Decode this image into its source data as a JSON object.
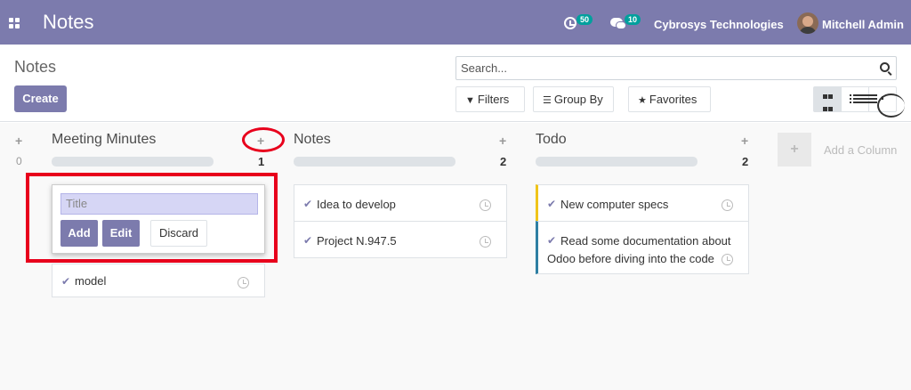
{
  "navbar": {
    "app_title": "Notes",
    "activity_count": "50",
    "message_count": "10",
    "company": "Cybrosys Technologies",
    "user": "Mitchell Admin"
  },
  "control_panel": {
    "breadcrumb": "Notes",
    "create_label": "Create",
    "search_placeholder": "Search...",
    "filters_label": "Filters",
    "groupby_label": "Group By",
    "favorites_label": "Favorites",
    "views": [
      "kanban",
      "list",
      "activity"
    ],
    "active_view": "kanban"
  },
  "columns": [
    {
      "title": "Meeting Minutes",
      "count": "1",
      "fold_count": "0",
      "cards": [
        {
          "title": "model"
        }
      ]
    },
    {
      "title": "Notes",
      "count": "2",
      "cards": [
        {
          "title": "Idea to develop"
        },
        {
          "title": "Project N.947.5"
        }
      ]
    },
    {
      "title": "Todo",
      "count": "2",
      "cards": [
        {
          "title": "New computer specs",
          "color": "#f0c419"
        },
        {
          "title": "Read some documentation about",
          "title2": "Odoo before diving into the code",
          "color": "#2e7fa3"
        }
      ]
    }
  ],
  "quick_create": {
    "placeholder": "Title",
    "add_label": "Add",
    "edit_label": "Edit",
    "discard_label": "Discard"
  },
  "add_column": {
    "label": "Add a Column"
  },
  "colors": {
    "primary": "#7c7bad",
    "badge": "#00a09d",
    "highlight": "#e8001c"
  }
}
